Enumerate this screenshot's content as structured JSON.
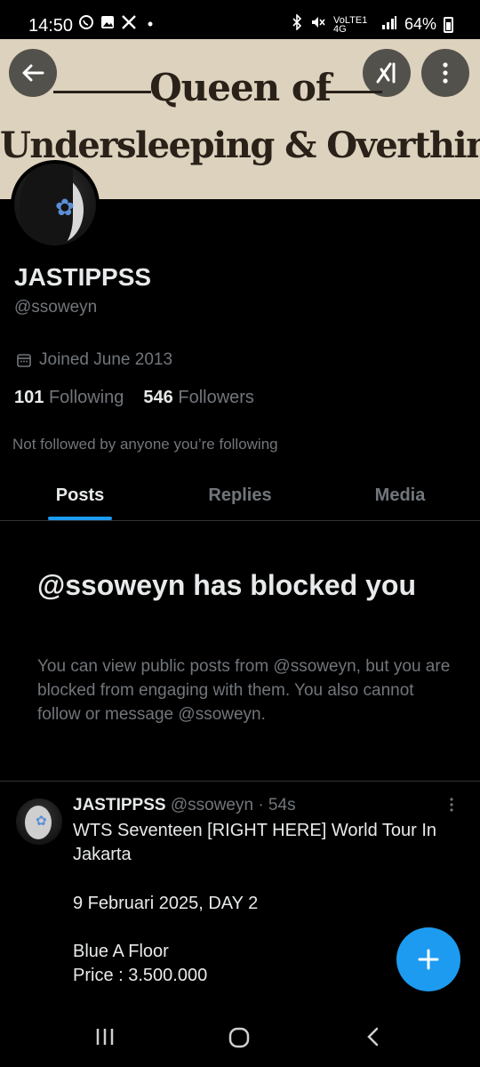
{
  "status_bar": {
    "time": "14:50",
    "left_icons": [
      "whatsapp-icon",
      "gallery-icon",
      "x-icon",
      "dot-icon"
    ],
    "signal_text": "VoLTE1 4G",
    "battery": "64%"
  },
  "banner": {
    "line1": "Queen of",
    "line2": "Undersleeping & Overthinking"
  },
  "profile": {
    "name": "JASTIPPSS",
    "handle": "@ssoweyn",
    "joined": "Joined June 2013",
    "following_count": "101",
    "following_label": "Following",
    "followers_count": "546",
    "followers_label": "Followers",
    "not_followed": "Not followed by anyone you’re following"
  },
  "tabs": [
    {
      "label": "Posts",
      "active": true
    },
    {
      "label": "Replies",
      "active": false
    },
    {
      "label": "Media",
      "active": false
    }
  ],
  "blocked": {
    "title": "@ssoweyn has blocked you",
    "body": "You can view public posts from @ssoweyn, but you are blocked from engaging with them. You also cannot follow or message @ssoweyn."
  },
  "tweet": {
    "name": "JASTIPPSS",
    "handle": "@ssoweyn",
    "time": "· 54s",
    "lines": [
      "WTS Seventeen [RIGHT HERE] World Tour In",
      "Jakarta",
      "",
      "9 Februari 2025, DAY 2",
      "",
      "Blue A Floor",
      "Price : 3.500.000"
    ]
  },
  "fab_label": "+",
  "colors": {
    "accent": "#1d9bf0",
    "muted": "#71767b",
    "text": "#e7e9ea",
    "background": "#000000"
  }
}
